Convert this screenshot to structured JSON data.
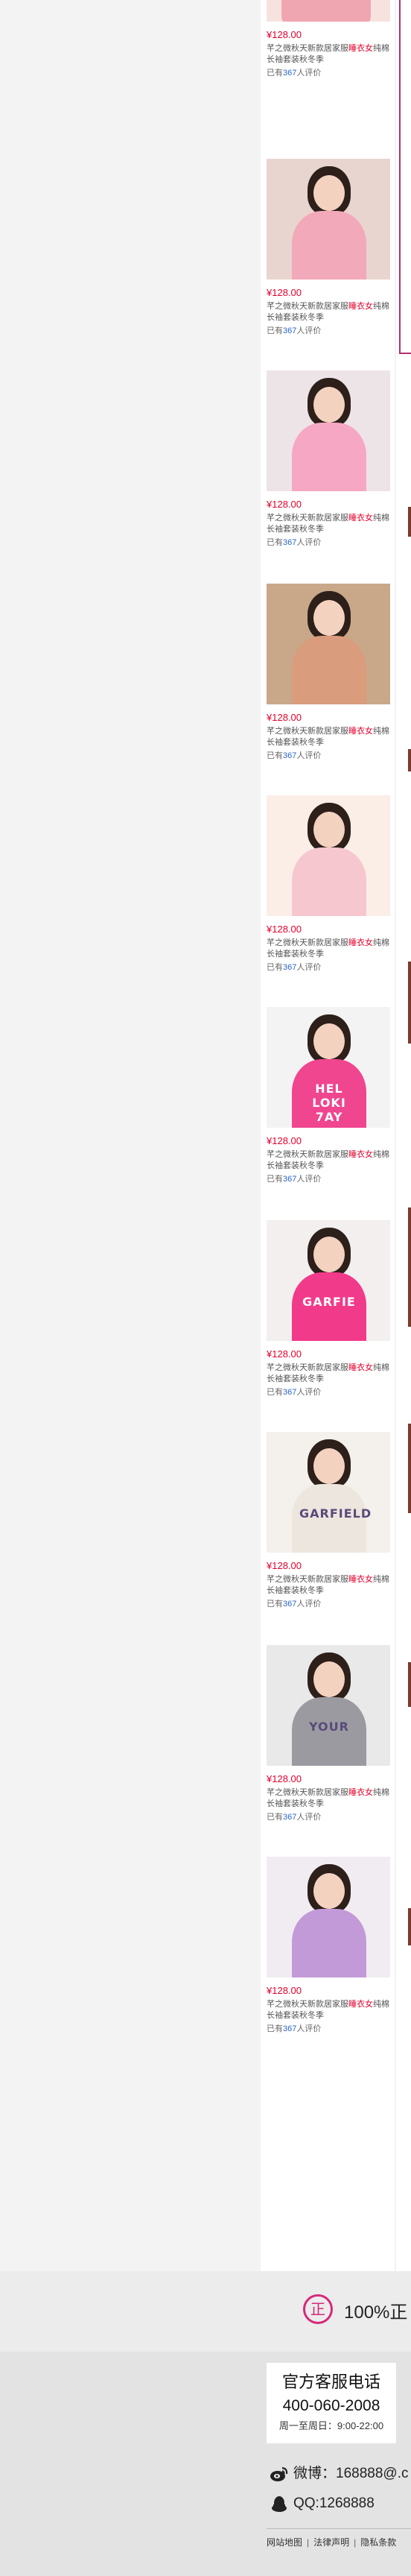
{
  "products": [
    {
      "price": "¥128.00",
      "title_a": "芊之微秋天新款居家服",
      "title_hl": "睡衣女",
      "title_b": "纯棉长袖套装秋冬季",
      "review_prefix": "已有",
      "review_count": "367",
      "review_suffix": "人评价"
    },
    {
      "price": "¥128.00",
      "title_a": "芊之微秋天新款居家服",
      "title_hl": "睡衣女",
      "title_b": "纯棉长袖套装秋冬季",
      "review_prefix": "已有",
      "review_count": "367",
      "review_suffix": "人评价"
    },
    {
      "price": "¥128.00",
      "title_a": "芊之微秋天新款居家服",
      "title_hl": "睡衣女",
      "title_b": "纯棉长袖套装秋冬季",
      "review_prefix": "已有",
      "review_count": "367",
      "review_suffix": "人评价"
    },
    {
      "price": "¥128.00",
      "title_a": "芊之微秋天新款居家服",
      "title_hl": "睡衣女",
      "title_b": "纯棉长袖套装秋冬季",
      "review_prefix": "已有",
      "review_count": "367",
      "review_suffix": "人评价"
    },
    {
      "price": "¥128.00",
      "title_a": "芊之微秋天新款居家服",
      "title_hl": "睡衣女",
      "title_b": "纯棉长袖套装秋冬季",
      "review_prefix": "已有",
      "review_count": "367",
      "review_suffix": "人评价"
    },
    {
      "price": "¥128.00",
      "title_a": "芊之微秋天新款居家服",
      "title_hl": "睡衣女",
      "title_b": "纯棉长袖套装秋冬季",
      "review_prefix": "已有",
      "review_count": "367",
      "review_suffix": "人评价"
    },
    {
      "price": "¥128.00",
      "title_a": "芊之微秋天新款居家服",
      "title_hl": "睡衣女",
      "title_b": "纯棉长袖套装秋冬季",
      "review_prefix": "已有",
      "review_count": "367",
      "review_suffix": "人评价"
    },
    {
      "price": "¥128.00",
      "title_a": "芊之微秋天新款居家服",
      "title_hl": "睡衣女",
      "title_b": "纯棉长袖套装秋冬季",
      "review_prefix": "已有",
      "review_count": "367",
      "review_suffix": "人评价"
    },
    {
      "price": "¥128.00",
      "title_a": "芊之微秋天新款居家服",
      "title_hl": "睡衣女",
      "title_b": "纯棉长袖套装秋冬季",
      "review_prefix": "已有",
      "review_count": "367",
      "review_suffix": "人评价"
    },
    {
      "price": "¥128.00",
      "title_a": "芊之微秋天新款居家服",
      "title_hl": "睡衣女",
      "title_b": "纯棉长袖套装秋冬季",
      "review_prefix": "已有",
      "review_count": "367",
      "review_suffix": "人评价"
    }
  ],
  "print_texts": {
    "p6": "HEL LOKI 7AY",
    "p7": "GARFIE",
    "p8": "GARFIELD",
    "p9": "YOUR"
  },
  "guarantee": {
    "icon_char": "正",
    "text": "100%正"
  },
  "service": {
    "title": "官方客服电话",
    "phone": "400-060-2008",
    "hours": "周一至周日：9:00-22:00"
  },
  "social": {
    "weibo_icon": "weibo-icon",
    "weibo": "微博：168888@.c",
    "qq_icon": "qq-penguin-icon",
    "qq": "QQ:1268888"
  },
  "footer_links": [
    "网站地图",
    "法律声明",
    "隐私条款"
  ],
  "colors": {
    "price": "#e3002b",
    "accent": "#d6297a",
    "link": "#2a65c8"
  }
}
